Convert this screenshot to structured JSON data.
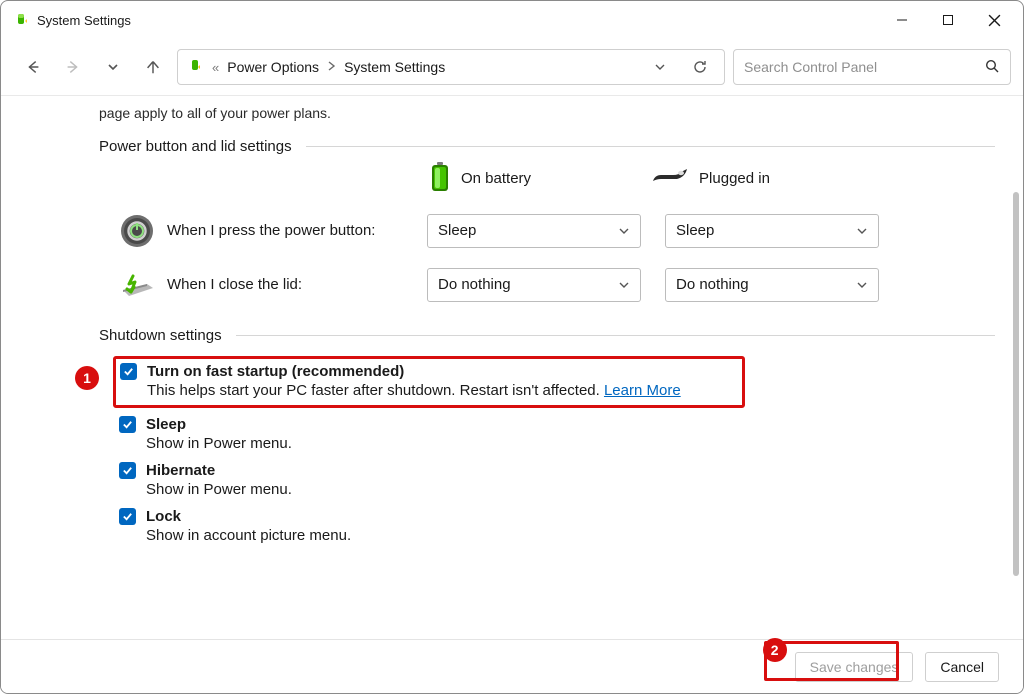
{
  "window": {
    "title": "System Settings"
  },
  "breadcrumb": {
    "prefix": "«",
    "parent": "Power Options",
    "current": "System Settings"
  },
  "search": {
    "placeholder": "Search Control Panel"
  },
  "intro": "page apply to all of your power plans.",
  "sections": {
    "power_button": {
      "heading": "Power button and lid settings",
      "col_battery": "On battery",
      "col_plugged": "Plugged in",
      "rows": [
        {
          "label": "When I press the power button:",
          "battery": "Sleep",
          "plugged": "Sleep"
        },
        {
          "label": "When I close the lid:",
          "battery": "Do nothing",
          "plugged": "Do nothing"
        }
      ]
    },
    "shutdown": {
      "heading": "Shutdown settings",
      "items": [
        {
          "title": "Turn on fast startup (recommended)",
          "desc": "This helps start your PC faster after shutdown. Restart isn't affected.",
          "link": "Learn More",
          "checked": true
        },
        {
          "title": "Sleep",
          "desc": "Show in Power menu.",
          "checked": true
        },
        {
          "title": "Hibernate",
          "desc": "Show in Power menu.",
          "checked": true
        },
        {
          "title": "Lock",
          "desc": "Show in account picture menu.",
          "checked": true
        }
      ]
    }
  },
  "footer": {
    "save": "Save changes",
    "cancel": "Cancel"
  },
  "annotations": {
    "one": "1",
    "two": "2"
  }
}
